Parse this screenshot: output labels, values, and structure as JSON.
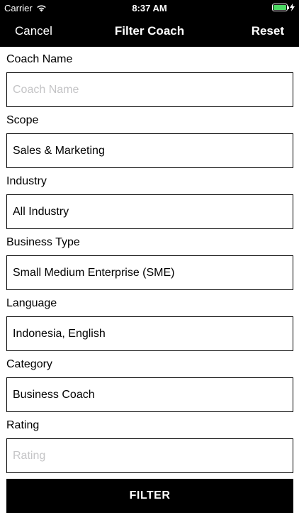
{
  "status_bar": {
    "carrier": "Carrier",
    "time": "8:37 AM",
    "wifi_icon": "wifi-icon",
    "battery_icon": "battery-icon",
    "charging_icon": "bolt-icon",
    "battery_color": "#4cd964"
  },
  "nav": {
    "cancel_label": "Cancel",
    "title": "Filter Coach",
    "reset_label": "Reset"
  },
  "form": {
    "coach_name": {
      "label": "Coach Name",
      "value": "",
      "placeholder": "Coach Name"
    },
    "scope": {
      "label": "Scope",
      "value": "Sales & Marketing",
      "placeholder": ""
    },
    "industry": {
      "label": "Industry",
      "value": "All Industry",
      "placeholder": ""
    },
    "business_type": {
      "label": "Business Type",
      "value": "Small Medium Enterprise (SME)",
      "placeholder": ""
    },
    "language": {
      "label": "Language",
      "value": "Indonesia, English",
      "placeholder": ""
    },
    "category": {
      "label": "Category",
      "value": "Business Coach",
      "placeholder": ""
    },
    "rating": {
      "label": "Rating",
      "value": "",
      "placeholder": "Rating"
    }
  },
  "filter_button_label": "FILTER"
}
